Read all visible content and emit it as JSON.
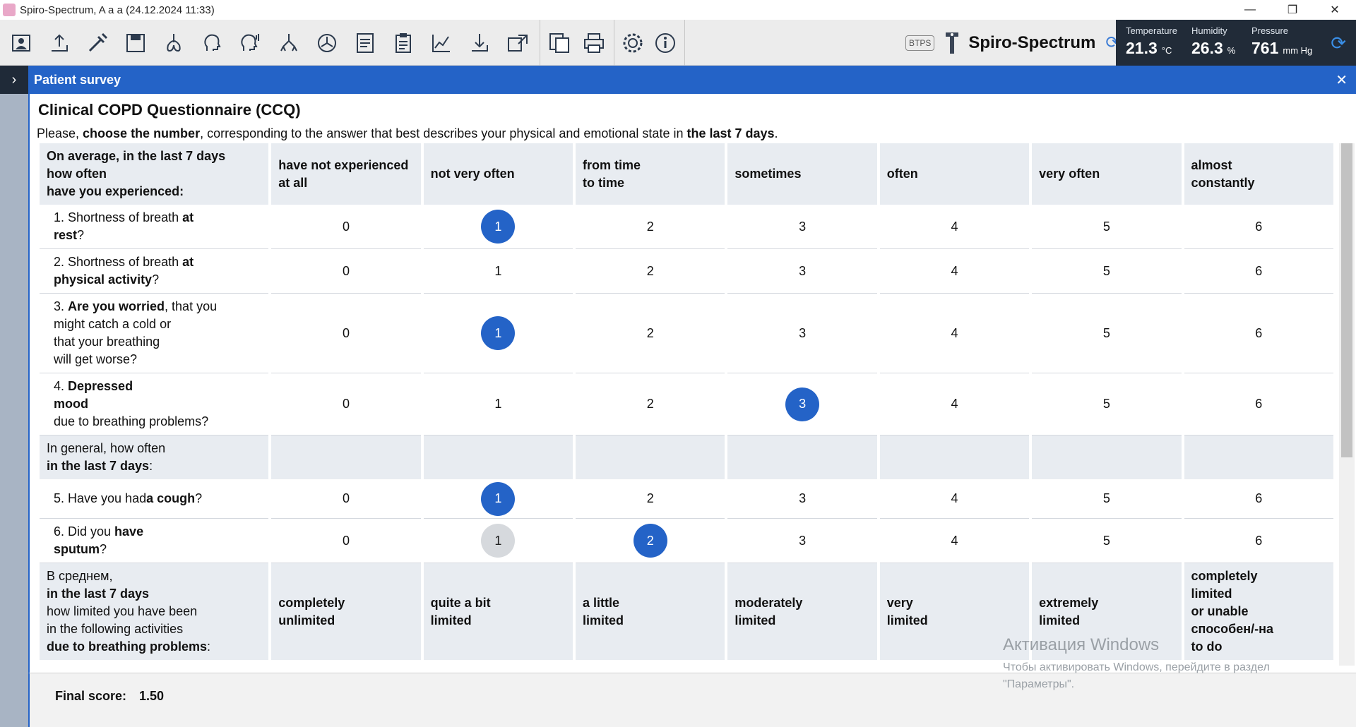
{
  "window": {
    "title": "Spiro-Spectrum, A a a (24.12.2024 11:33)",
    "controls": [
      "—",
      "❐",
      "✕"
    ]
  },
  "toolbar": {
    "groups": [
      [
        "patient-card-icon",
        "export-icon",
        "syringe-icon",
        "save-icon",
        "lungs-icon",
        "head-profile-icon",
        "head-signal-icon",
        "bronchi-icon",
        "fan-icon",
        "report-icon",
        "clipboard-icon",
        "chart-icon",
        "download-icon",
        "transfer-icon"
      ],
      [
        "documents-icon",
        "printer-icon"
      ],
      [
        "settings-icon",
        "info-icon"
      ]
    ]
  },
  "brand": {
    "btps": "BTPS",
    "name": "Spiro-Spectrum"
  },
  "environment": {
    "temperature": {
      "label": "Temperature",
      "value": "21.3",
      "unit": "°C"
    },
    "humidity": {
      "label": "Humidity",
      "value": "26.3",
      "unit": "%"
    },
    "pressure": {
      "label": "Pressure",
      "value": "761",
      "unit": "mm Hg"
    }
  },
  "panel": {
    "title": "Patient survey",
    "close": "✕",
    "toggle": "›"
  },
  "questionnaire": {
    "title": "Clinical COPD Questionnaire (CCQ)",
    "instruction_parts": [
      "Please, ",
      "choose the number",
      ", corresponding to the answer that best describes your physical and emotional state in ",
      "the last 7 days",
      "."
    ],
    "header_question": [
      "On average, in the last 7 days",
      "how often",
      "have you experienced:"
    ],
    "columns": [
      [
        "have not experienced",
        "at all"
      ],
      [
        "not very often"
      ],
      [
        "from time",
        "to time"
      ],
      [
        "sometimes"
      ],
      [
        "often"
      ],
      [
        "very often"
      ],
      [
        "almost",
        "constantly"
      ]
    ],
    "questions": [
      {
        "parts": [
          [
            "1. Shortness of breath ",
            false
          ],
          [
            "at",
            true
          ],
          [
            "\nrest",
            true
          ],
          [
            "?",
            false
          ]
        ],
        "selected": 1,
        "previous": null
      },
      {
        "parts": [
          [
            "2. Shortness of breath ",
            false
          ],
          [
            "at",
            true
          ],
          [
            "\nphysical activity",
            true
          ],
          [
            "?",
            false
          ]
        ],
        "selected": null,
        "previous": null
      },
      {
        "parts": [
          [
            "3. ",
            false
          ],
          [
            "Are you worried",
            true
          ],
          [
            ", that you\nmight catch a cold or\nthat your breathing\nwill get worse?",
            false
          ]
        ],
        "selected": 1,
        "previous": null
      },
      {
        "parts": [
          [
            "4. ",
            false
          ],
          [
            "Depressed\nmood",
            true
          ],
          [
            "\ndue to breathing problems?",
            false
          ]
        ],
        "selected": 3,
        "previous": null
      }
    ],
    "section2_header": {
      "parts": [
        [
          "In general, how often\n",
          false
        ],
        [
          "in the last 7 days",
          true
        ],
        [
          ":",
          false
        ]
      ]
    },
    "questions2": [
      {
        "parts": [
          [
            "5. Have you had",
            false
          ],
          [
            "a cough",
            true
          ],
          [
            "?",
            false
          ]
        ],
        "selected": 1,
        "previous": null
      },
      {
        "parts": [
          [
            "6. Did you ",
            false
          ],
          [
            "have\nsputum",
            true
          ],
          [
            "?",
            false
          ]
        ],
        "selected": 2,
        "previous": 1
      }
    ],
    "section3_header": {
      "parts": [
        [
          "В среднем,\n",
          false
        ],
        [
          "in the last 7 days",
          true
        ],
        [
          "\nhow limited you have been\nin the following activities\n",
          false
        ],
        [
          "due to breathing problems",
          true
        ],
        [
          ":",
          false
        ]
      ]
    },
    "section3_columns": [
      [
        "completely",
        "unlimited"
      ],
      [
        "quite a bit",
        "limited"
      ],
      [
        "a little",
        "limited"
      ],
      [
        "moderately",
        "limited"
      ],
      [
        "very",
        "limited"
      ],
      [
        "extremely",
        "limited"
      ],
      [
        "completely",
        "limited",
        "or unable",
        "способен/-на",
        "to do"
      ]
    ],
    "score_values": [
      "0",
      "1",
      "2",
      "3",
      "4",
      "5",
      "6"
    ]
  },
  "footer": {
    "label": "Final score:",
    "value": "1.50"
  },
  "watermark": {
    "title": "Активация Windows",
    "text": "Чтобы активировать Windows, перейдите в раздел \"Параметры\"."
  },
  "colors": {
    "accent": "#2463c7",
    "env_bg": "#212b38",
    "header_bg": "#e8ecf1",
    "previous": "#d6d9dd"
  }
}
